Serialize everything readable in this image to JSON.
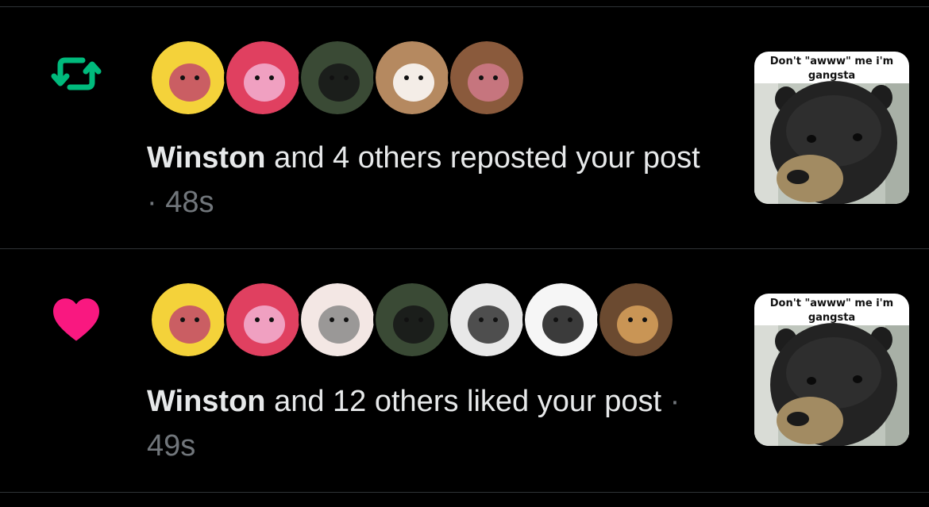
{
  "notifications": [
    {
      "type": "repost",
      "icon": "repost-icon",
      "icon_color": "#00ba7c",
      "avatars": [
        {
          "name": "avatar-yellow-cat",
          "bg": "#f4d23a",
          "accent": "#c24a6b"
        },
        {
          "name": "avatar-pink-bear",
          "bg": "#e04060",
          "accent": "#f2b2d2"
        },
        {
          "name": "avatar-black-bear-photo",
          "bg": "#3a4a35",
          "accent": "#161616"
        },
        {
          "name": "avatar-brown-bear",
          "bg": "#b58960",
          "accent": "#ffffff"
        },
        {
          "name": "avatar-brown-creature",
          "bg": "#8a5a3c",
          "accent": "#d07a8a"
        }
      ],
      "actor": "Winston",
      "text": " and 4 others reposted your post",
      "separator": " · ",
      "time": "48s",
      "thumbnail_caption": "Don't \"awww\" me i'm\ngangsta"
    },
    {
      "type": "like",
      "icon": "heart-icon",
      "icon_color": "#f91880",
      "avatars": [
        {
          "name": "avatar-yellow-cat",
          "bg": "#f4d23a",
          "accent": "#c24a6b"
        },
        {
          "name": "avatar-pink-bear",
          "bg": "#e04060",
          "accent": "#f2b2d2"
        },
        {
          "name": "avatar-white-wolf",
          "bg": "#f3e7e4",
          "accent": "#8a8a8a"
        },
        {
          "name": "avatar-black-bear-photo",
          "bg": "#3a4a35",
          "accent": "#161616"
        },
        {
          "name": "avatar-deer-sketch",
          "bg": "#e8e8e8",
          "accent": "#333333"
        },
        {
          "name": "avatar-polar-bear",
          "bg": "#f6f6f6",
          "accent": "#1a1a1a"
        },
        {
          "name": "avatar-blond-character",
          "bg": "#6b4a30",
          "accent": "#d9a25c"
        }
      ],
      "actor": "Winston",
      "text": " and 12 others liked your post",
      "separator": " · ",
      "time": "49s",
      "thumbnail_caption": "Don't \"awww\" me i'm\ngangsta"
    }
  ]
}
